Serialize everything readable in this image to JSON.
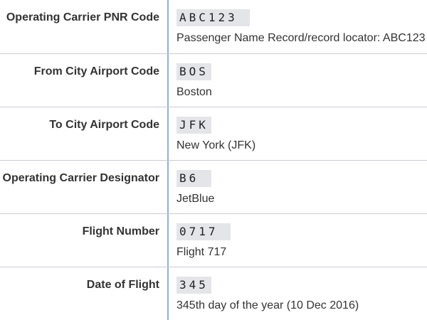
{
  "rows": [
    {
      "label": "Operating Carrier PNR Code",
      "code": "ABC123 ",
      "description": "Passenger Name Record/record locator: ABC123"
    },
    {
      "label": "From City Airport Code",
      "code": "BOS",
      "description": "Boston"
    },
    {
      "label": "To City Airport Code",
      "code": "JFK",
      "description": "New York (JFK)"
    },
    {
      "label": "Operating Carrier Designator",
      "code": "B6 ",
      "description": "JetBlue"
    },
    {
      "label": "Flight Number",
      "code": "0717 ",
      "description": "Flight 717"
    },
    {
      "label": "Date of Flight",
      "code": "345",
      "description": "345th day of the year (10 Dec 2016)"
    }
  ]
}
